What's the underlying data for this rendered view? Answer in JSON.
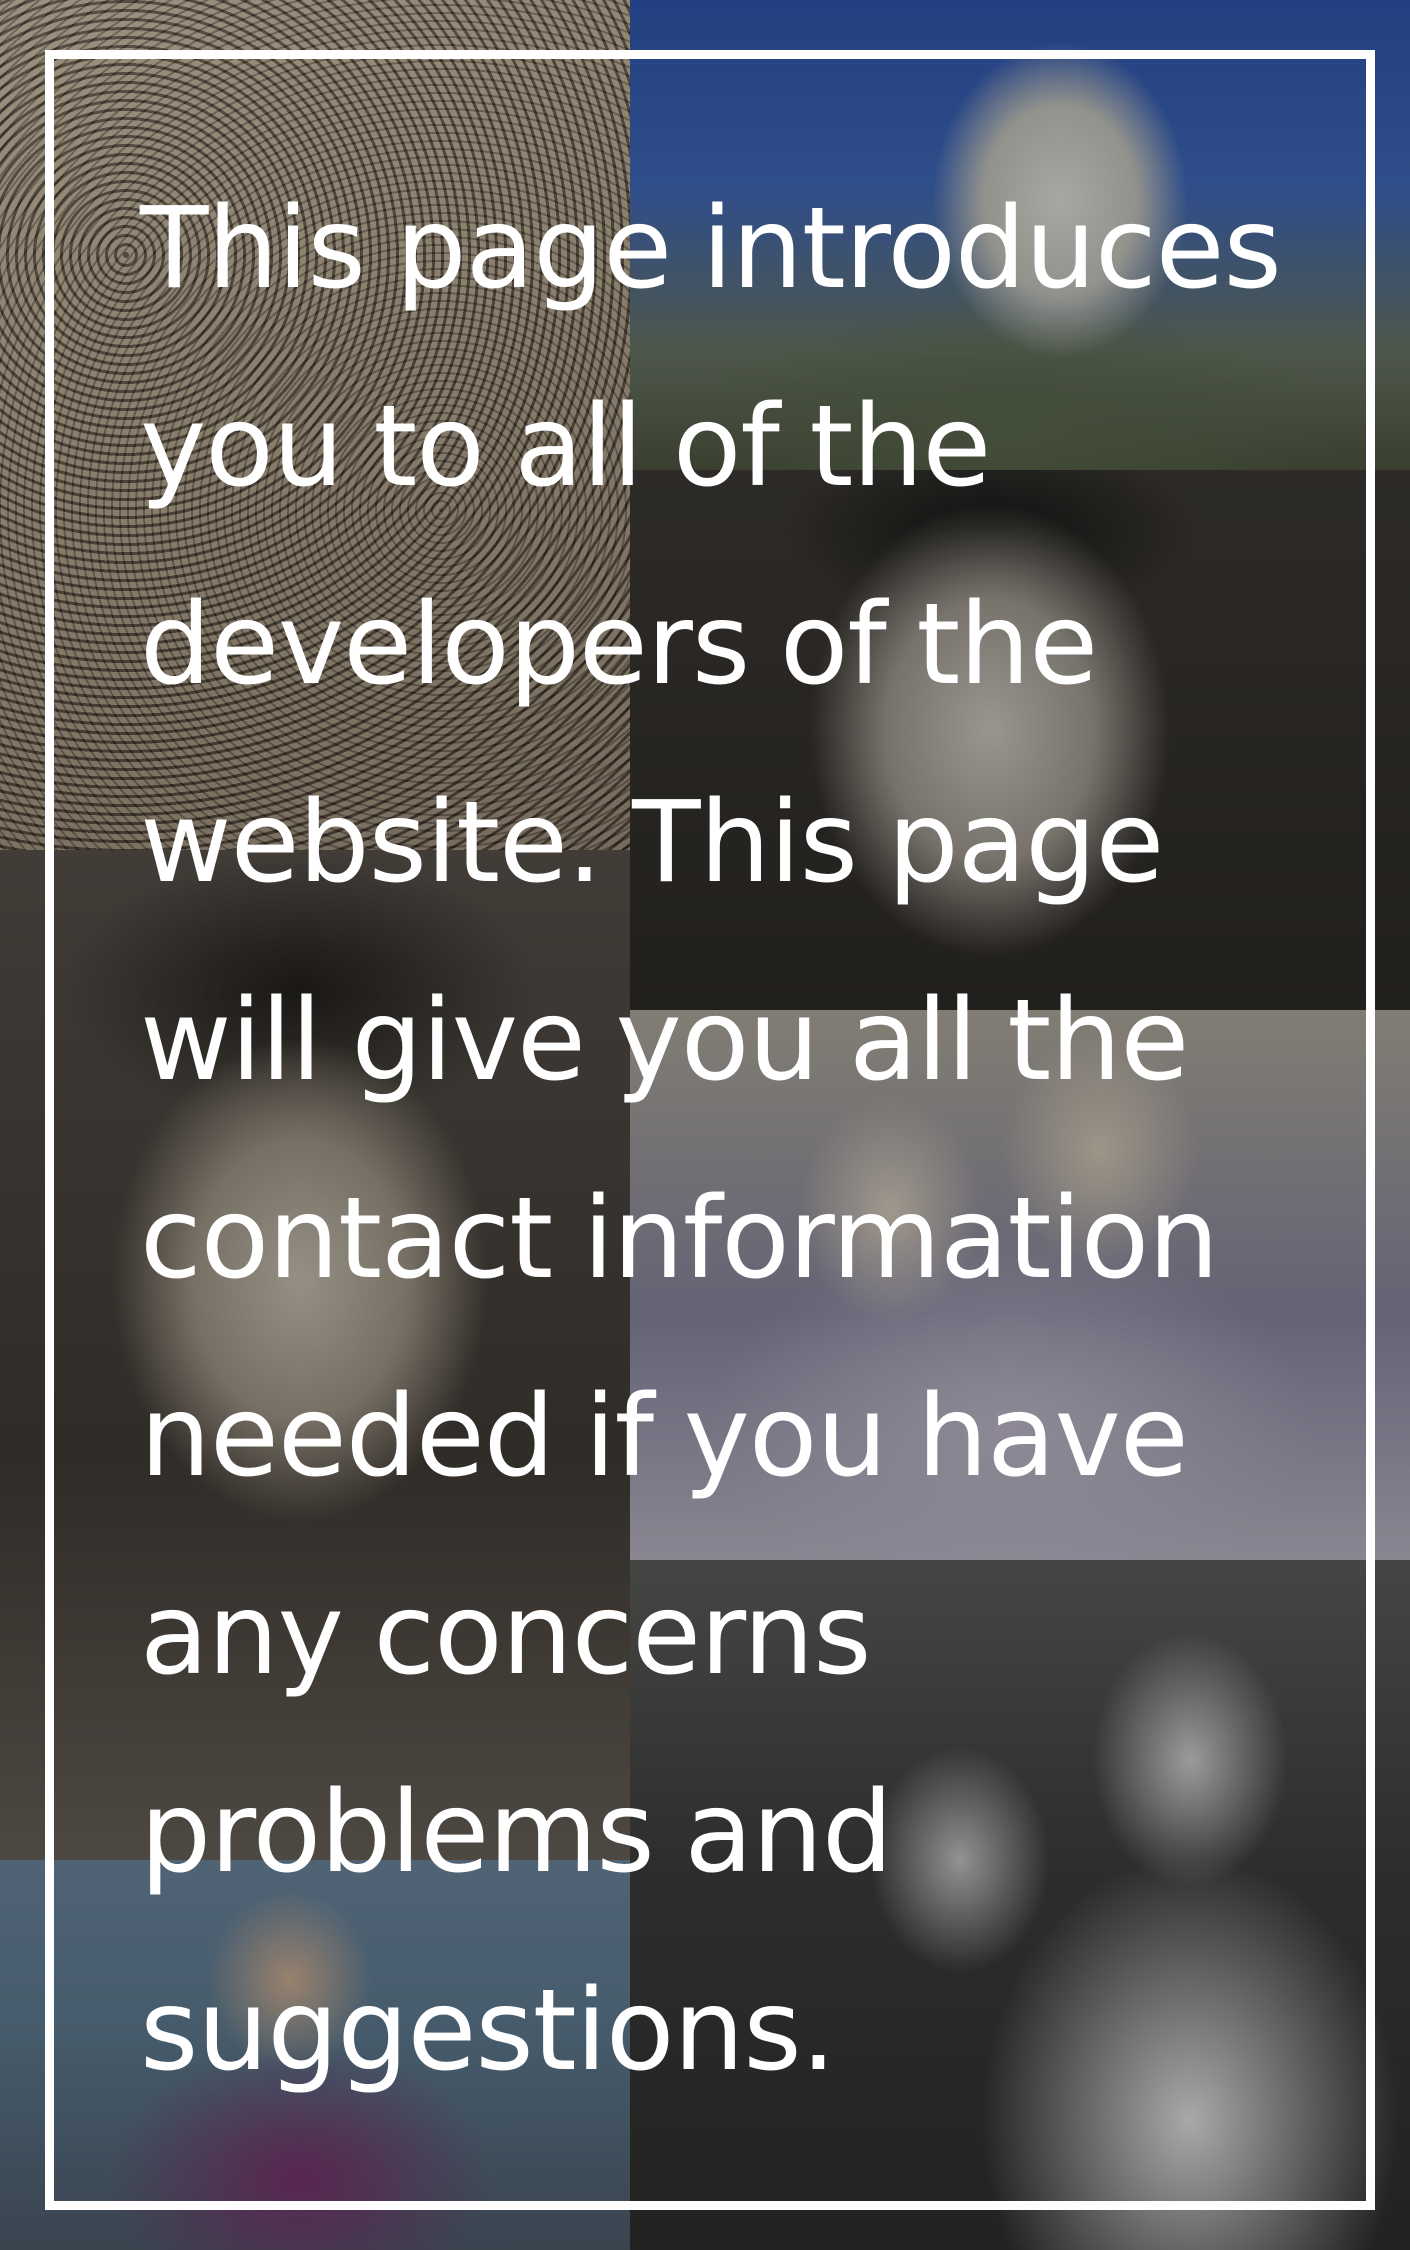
{
  "background": {
    "photos": [
      "crowd-march-photo",
      "stone-bust-photo",
      "young-man-portrait-photo",
      "boy-portrait-photo",
      "couple-photo",
      "man-and-woman-photo",
      "woman-in-floral-dress-photo"
    ]
  },
  "frame": {
    "color": "#ffffff"
  },
  "intro": {
    "text": "This page introduces you to all of the developers of the website. This page will give you all the contact information needed if you have any concerns problems and suggestions."
  }
}
